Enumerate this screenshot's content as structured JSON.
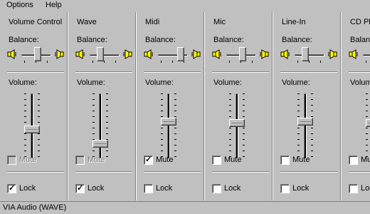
{
  "menu": [
    "Options",
    "Help"
  ],
  "balance_label": "Balance:",
  "volume_label": "Volume:",
  "channels": [
    {
      "title": "Volume Control",
      "balance": 0.55,
      "volume": 0.45,
      "mute_label": "Mute",
      "mute": false,
      "mute_enabled": false,
      "lock_label": "Lock",
      "lock": true
    },
    {
      "title": "Wave",
      "balance": 0.3,
      "volume": 0.2,
      "mute_label": "Mute",
      "mute": false,
      "mute_enabled": false,
      "lock_label": "Lock",
      "lock": true
    },
    {
      "title": "Midi",
      "balance": 0.85,
      "volume": 0.58,
      "mute_label": "Mute",
      "mute": true,
      "mute_enabled": true,
      "lock_label": "Lock",
      "lock": false
    },
    {
      "title": "Mic",
      "balance": 0.55,
      "volume": 0.55,
      "mute_label": "Mute",
      "mute": false,
      "mute_enabled": true,
      "lock_label": "Lock",
      "lock": false
    },
    {
      "title": "Line-In",
      "balance": 0.3,
      "volume": 0.58,
      "mute_label": "Mute",
      "mute": false,
      "mute_enabled": true,
      "lock_label": "Lock",
      "lock": false
    },
    {
      "title": "CD Player",
      "balance": 0.55,
      "volume": 0.55,
      "mute_label": "Mute",
      "mute": false,
      "mute_enabled": true,
      "lock_label": "Lock",
      "lock": false
    }
  ],
  "status": "VIA Audio (WAVE)"
}
